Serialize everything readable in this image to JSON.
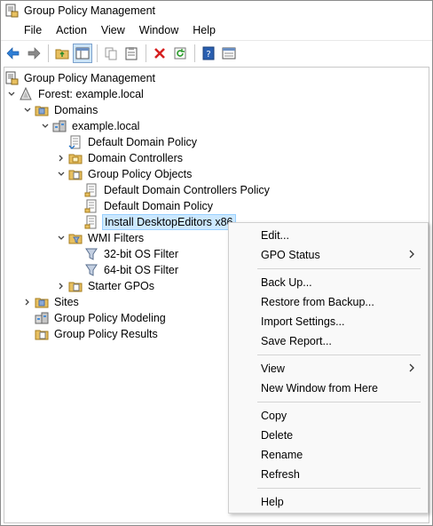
{
  "window": {
    "title": "Group Policy Management"
  },
  "menubar": {
    "items": [
      "File",
      "Action",
      "View",
      "Window",
      "Help"
    ]
  },
  "toolbar": {
    "buttons": [
      "back-icon",
      "forward-icon",
      "up-folder-icon",
      "show-hide-tree-icon",
      "copy-icon",
      "paste-icon",
      "delete-icon",
      "refresh-icon",
      "help-icon",
      "properties-icon"
    ]
  },
  "tree": {
    "root": "Group Policy Management",
    "forest": "Forest: example.local",
    "domains": "Domains",
    "domain": "example.local",
    "default_domain_policy_link": "Default Domain Policy",
    "domain_controllers": "Domain Controllers",
    "gpo_container": "Group Policy Objects",
    "gpo_default_dc_policy": "Default Domain Controllers Policy",
    "gpo_default_domain_policy": "Default Domain Policy",
    "gpo_install": "Install DesktopEditors x86",
    "wmi_filters": "WMI Filters",
    "wmi_32": "32-bit OS Filter",
    "wmi_64": "64-bit OS Filter",
    "starter_gpos": "Starter GPOs",
    "sites": "Sites",
    "gp_modeling": "Group Policy Modeling",
    "gp_results": "Group Policy Results"
  },
  "context_menu": {
    "edit": "Edit...",
    "gpo_status": "GPO Status",
    "back_up": "Back Up...",
    "restore": "Restore from Backup...",
    "import": "Import Settings...",
    "save_report": "Save Report...",
    "view": "View",
    "new_window": "New Window from Here",
    "copy": "Copy",
    "delete": "Delete",
    "rename": "Rename",
    "refresh": "Refresh",
    "help": "Help"
  },
  "colors": {
    "selection_fill": "#cce8ff",
    "selection_border": "#99d1ff",
    "toolbar_accent": "#1f6fc4",
    "delete_red": "#d62020"
  }
}
